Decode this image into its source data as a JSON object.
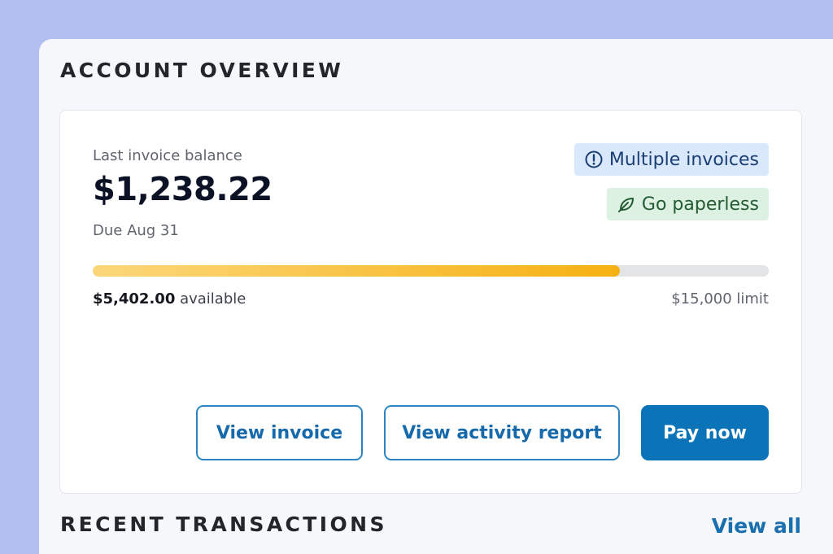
{
  "account_overview": {
    "title": "ACCOUNT OVERVIEW",
    "balance_label": "Last invoice balance",
    "balance_amount": "$1,238.22",
    "due_date": "Due Aug 31",
    "badges": {
      "multiple_invoices": "Multiple invoices",
      "go_paperless": "Go paperless"
    },
    "credit": {
      "available_amount": "$5,402.00",
      "available_suffix": " available",
      "limit_text": "$15,000 limit",
      "used_fraction": 0.78
    },
    "buttons": {
      "view_invoice": "View invoice",
      "view_activity_report": "View activity report",
      "pay_now": "Pay now"
    }
  },
  "recent_transactions": {
    "title": "RECENT TRANSACTIONS",
    "view_all": "View all"
  },
  "colors": {
    "page_background": "#b1bff0",
    "accent_blue": "#0b73b7",
    "progress_gold": "#f5b112",
    "info_badge_bg": "#d9e8fb",
    "success_badge_bg": "#dcf1e2"
  },
  "icons": {
    "multiple_invoices": "info-circle-icon",
    "go_paperless": "leaf-icon"
  }
}
